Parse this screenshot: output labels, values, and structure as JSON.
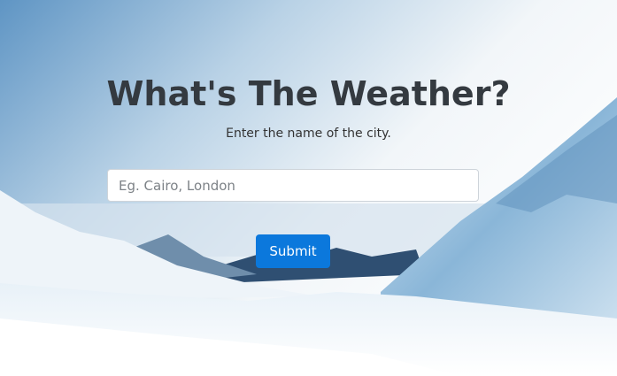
{
  "header": {
    "title": "What's The Weather?",
    "subtitle": "Enter the name of the city."
  },
  "form": {
    "city_placeholder": "Eg. Cairo, London",
    "city_value": "",
    "submit_label": "Submit"
  },
  "colors": {
    "primary": "#0b78dc",
    "title": "#343a40"
  }
}
